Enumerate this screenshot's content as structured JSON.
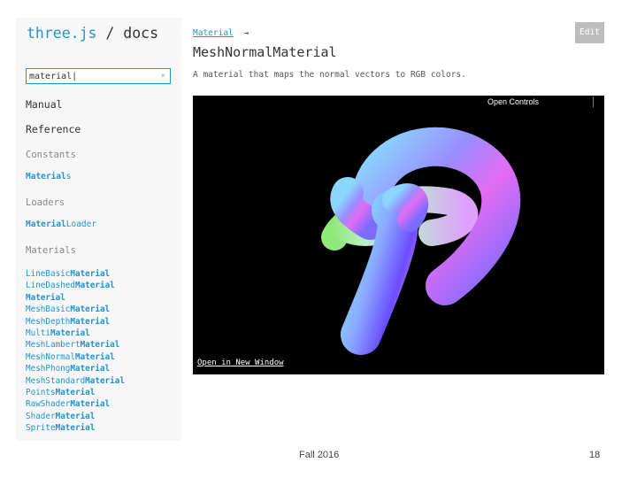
{
  "brand": {
    "name": "three.js",
    "slash": "/",
    "section": "docs"
  },
  "search": {
    "value": "material",
    "clear_icon": "×"
  },
  "sidebar": {
    "manual": "Manual",
    "reference": "Reference",
    "constants": {
      "heading": "Constants",
      "link_match": "Material",
      "link_rest": "s"
    },
    "loaders": {
      "heading": "Loaders",
      "link_match": "Material",
      "link_rest": "Loader"
    },
    "materials": {
      "heading": "Materials",
      "items": [
        {
          "pre": "LineBasic",
          "match": "Material",
          "post": ""
        },
        {
          "pre": "LineDashed",
          "match": "Material",
          "post": ""
        },
        {
          "pre": "",
          "match": "Material",
          "post": ""
        },
        {
          "pre": "MeshBasic",
          "match": "Material",
          "post": ""
        },
        {
          "pre": "MeshDepth",
          "match": "Material",
          "post": ""
        },
        {
          "pre": "Multi",
          "match": "Material",
          "post": ""
        },
        {
          "pre": "MeshLambert",
          "match": "Material",
          "post": ""
        },
        {
          "pre": "MeshNormal",
          "match": "Material",
          "post": ""
        },
        {
          "pre": "MeshPhong",
          "match": "Material",
          "post": ""
        },
        {
          "pre": "MeshStandard",
          "match": "Material",
          "post": ""
        },
        {
          "pre": "Points",
          "match": "Material",
          "post": ""
        },
        {
          "pre": "RawShader",
          "match": "Material",
          "post": ""
        },
        {
          "pre": "Shader",
          "match": "Material",
          "post": ""
        },
        {
          "pre": "Sprite",
          "match": "Material",
          "post": ""
        }
      ]
    }
  },
  "main": {
    "breadcrumb_link": "Material",
    "breadcrumb_arrow": "→",
    "title": "MeshNormalMaterial",
    "description": "A material that maps the normal vectors to RGB colors.",
    "edit_label": "Edit",
    "viewer": {
      "open_controls": "Open Controls",
      "open_window": "Open in New Window"
    }
  },
  "footer": {
    "term": "Fall 2016",
    "page": "18"
  },
  "colors": {
    "accent": "#2194ce",
    "sidebar_bg": "#f7f7f7",
    "viewer_bg": "#000000",
    "edit_bg": "#bdbdbd"
  }
}
